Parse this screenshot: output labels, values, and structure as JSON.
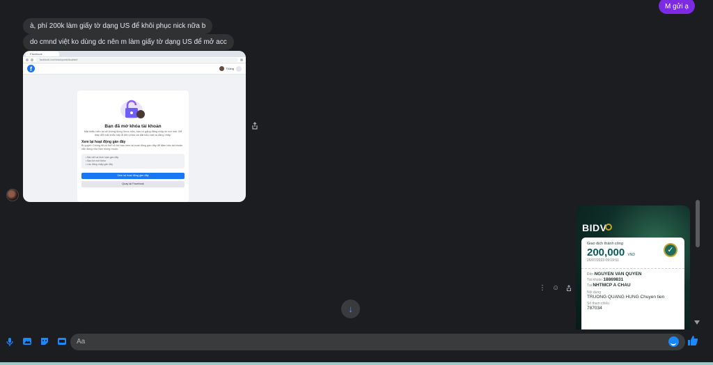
{
  "conversation": {
    "outgoing_messages": [
      "M gửi ạ"
    ],
    "incoming_messages": [
      "à, phí 200k làm giấy tờ dạng US để khôi phục nick nữa b",
      "do cmnd việt ko dùng dc nên m làm giấy tờ dạng US để mở acc"
    ]
  },
  "screenshot_attachment": {
    "browser_tab": "Facebook",
    "url": "facebook.com/checkpoint/disabled/",
    "user_name": "Thang",
    "card_title": "Bạn đã mở khóa tài khoản",
    "card_text": "Mật khẩu hiện tại sẽ không dùng được nữa, bạn có gắng đăng nhập từ nơi mới. Để thay đổi mật khẩu hãy đi đến phần cài đặt bảo mật và đăng nhập.",
    "section_title": "Xem lại hoạt động gần đây",
    "section_text": "Bị quyết: Chúng tôi có thể hỗ trợ bạn xem lại hoạt động gần đây để đảm bảo tài khoản vẫn đang như bạn mong muốn.",
    "list_items": [
      "Bài viết và bình luận gần đây",
      "Bạn bè mới thêm",
      "Lần đăng nhập gần đây"
    ],
    "primary_button": "Xem lại hoạt động gần đây",
    "secondary_button": "Quay lại Facebook"
  },
  "receipt": {
    "bank": "BIDV",
    "status": "Giao dịch thành công",
    "amount": "200,000",
    "currency": "VND",
    "datetime": "26/07/2023 09:19:51",
    "to_label": "Đến",
    "to_name": "NGUYEN VAN QUYEN",
    "account_label": "Tài khoản",
    "account_number": "18869831",
    "bank_label": "Tại",
    "bank_name": "NHTMCP A CHAU",
    "content_label": "Nội dung",
    "content": "TRUONG QUANG HUNG Chuyen tien",
    "ref_label": "Số tham chiếu",
    "ref": "787034"
  },
  "composer": {
    "placeholder": "Aa"
  },
  "icons": [
    "mic-icon",
    "image-icon",
    "sticker-icon",
    "gif-icon",
    "emoji-icon",
    "like-icon",
    "share-icon",
    "more-icon",
    "react-icon",
    "scroll-down-icon"
  ],
  "colors": {
    "outgoing_bubble": "#7c2be3",
    "incoming_bubble": "#303133",
    "accent": "#1a88ff"
  }
}
